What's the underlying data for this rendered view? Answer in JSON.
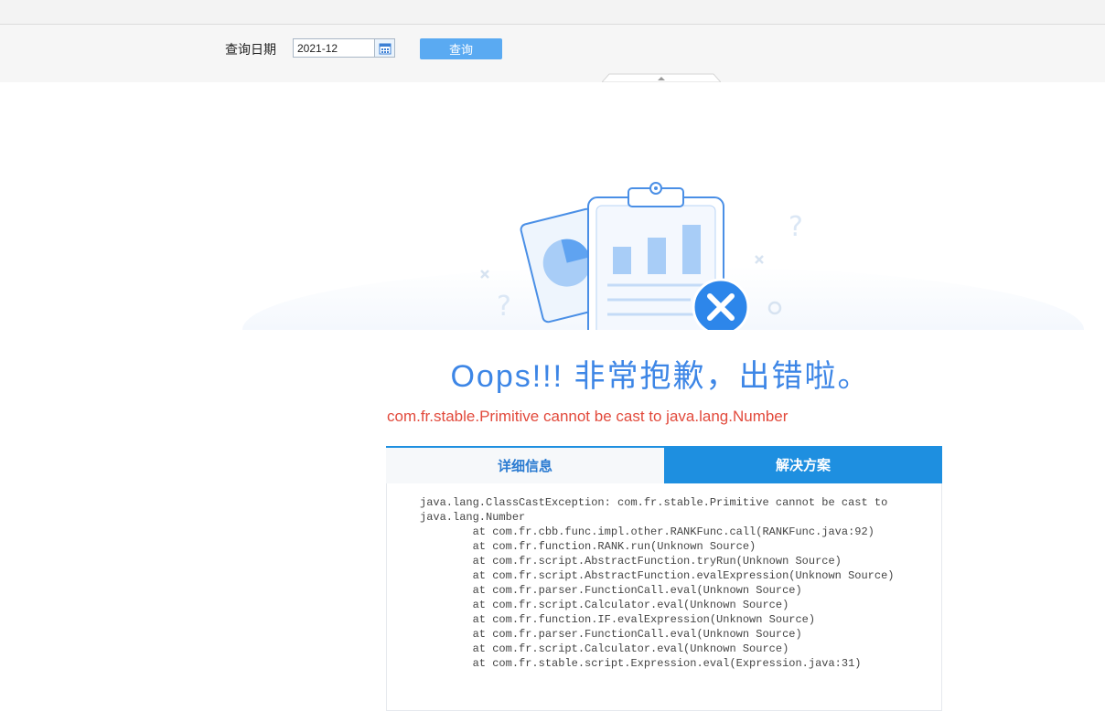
{
  "toolbar": {
    "query_date_label": "查询日期",
    "date_value": "2021-12",
    "query_button": "查询"
  },
  "error": {
    "title": "Oops!!! 非常抱歉，出错啦。",
    "message": "com.fr.stable.Primitive cannot be cast to java.lang.Number"
  },
  "tabs": {
    "detail": "详细信息",
    "solution": "解决方案"
  },
  "stacktrace": "java.lang.ClassCastException: com.fr.stable.Primitive cannot be cast to\njava.lang.Number\n        at com.fr.cbb.func.impl.other.RANKFunc.call(RANKFunc.java:92)\n        at com.fr.function.RANK.run(Unknown Source)\n        at com.fr.script.AbstractFunction.tryRun(Unknown Source)\n        at com.fr.script.AbstractFunction.evalExpression(Unknown Source)\n        at com.fr.parser.FunctionCall.eval(Unknown Source)\n        at com.fr.script.Calculator.eval(Unknown Source)\n        at com.fr.function.IF.evalExpression(Unknown Source)\n        at com.fr.parser.FunctionCall.eval(Unknown Source)\n        at com.fr.script.Calculator.eval(Unknown Source)\n        at com.fr.stable.script.Expression.eval(Expression.java:31)",
  "colors": {
    "accent": "#1e8fe0",
    "title_blue": "#3d86e6",
    "error_red": "#e24a3c"
  }
}
